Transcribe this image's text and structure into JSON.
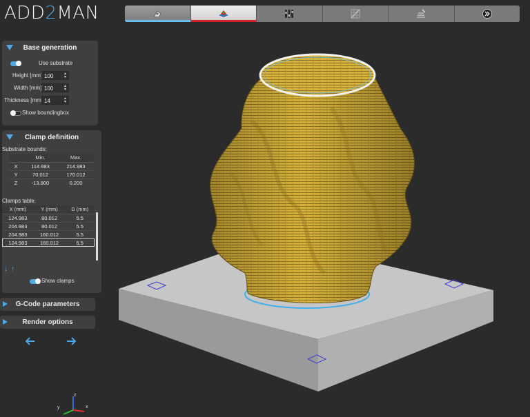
{
  "app": {
    "logo_a": "ADD",
    "logo_b": "2",
    "logo_c": "MAN"
  },
  "steps": [
    {
      "icon": "import-icon",
      "state": "done"
    },
    {
      "icon": "model-icon",
      "state": "active"
    },
    {
      "icon": "settings-sliders-icon",
      "state": "pending"
    },
    {
      "icon": "slicing-grid-icon",
      "state": "pending"
    },
    {
      "icon": "print-layers-icon",
      "state": "pending"
    },
    {
      "icon": "next-step-icon",
      "state": "pending"
    }
  ],
  "base_generation": {
    "title": "Base generation",
    "use_substrate_label": "Use substrate",
    "use_substrate": true,
    "height_label": "Height [mm]",
    "height": "100",
    "width_label": "Width [mm]",
    "width": "100",
    "thickness_label": "Thickness [mm]",
    "thickness": "14",
    "show_bbox_label": "Show boundingbox",
    "show_bbox": false
  },
  "clamp_definition": {
    "title": "Clamp definition",
    "bounds_label": "Substrate bounds:",
    "bounds_headers": [
      "",
      "Min.",
      "Max."
    ],
    "bounds_rows": [
      [
        "X",
        "114.983",
        "214.983"
      ],
      [
        "Y",
        "70.012",
        "170.012"
      ],
      [
        "Z",
        "-13.800",
        "0.200"
      ]
    ],
    "clamps_label": "Clamps table:",
    "clamps_headers": [
      "X (mm)",
      "Y (mm)",
      "D (mm)"
    ],
    "clamps_rows": [
      [
        "124.983",
        "80.012",
        "5.5"
      ],
      [
        "204.983",
        "80.012",
        "5.5"
      ],
      [
        "204.983",
        "160.012",
        "5.5"
      ],
      [
        "124.983",
        "160.012",
        "5.5"
      ]
    ],
    "show_clamps_label": "Show clamps",
    "show_clamps": true
  },
  "gcode": {
    "title": "G-Code parameters"
  },
  "render": {
    "title": "Render options"
  },
  "axes": {
    "x": "x",
    "y": "y",
    "z": "z"
  },
  "colors": {
    "accent": "#4fa8e6",
    "active_step": "#d0202a",
    "model": "#d9b43a",
    "substrate": "#c8c8c8"
  }
}
